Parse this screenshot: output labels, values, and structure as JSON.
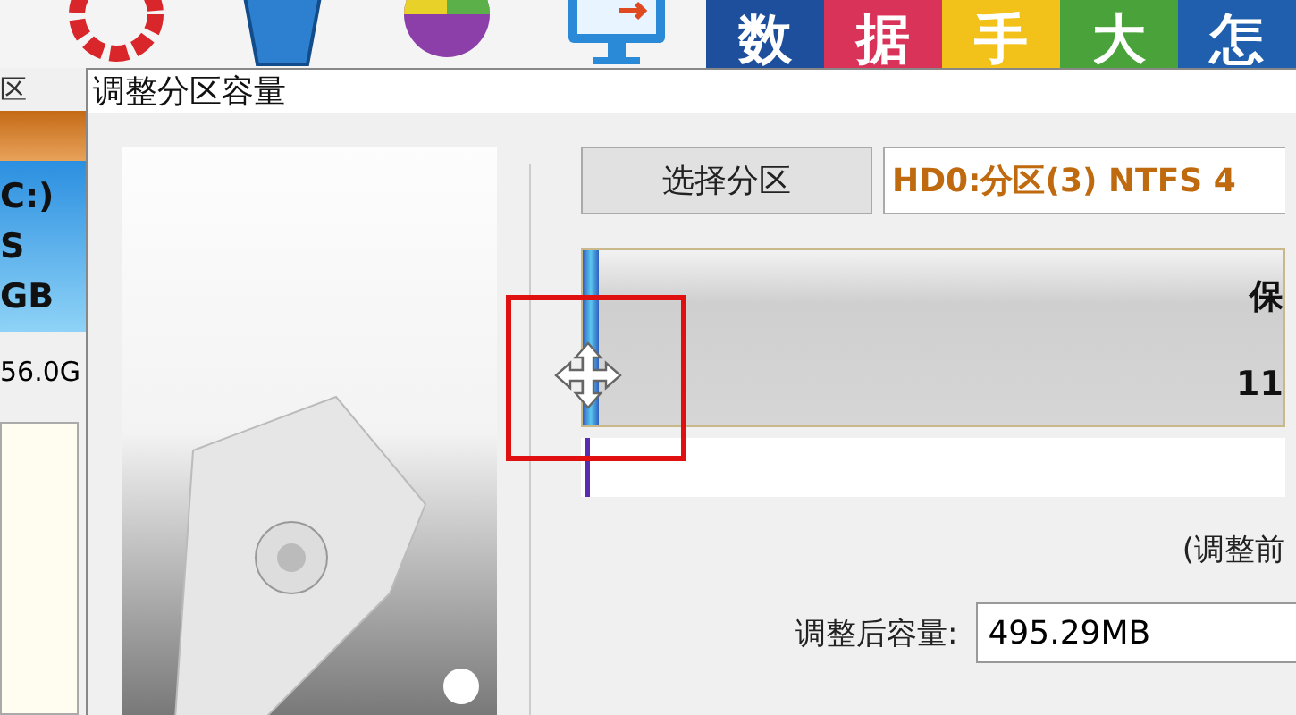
{
  "banner": {
    "tiles": [
      {
        "text": "数",
        "color": "#1d4f9c"
      },
      {
        "text": "据",
        "color": "#d9335a"
      },
      {
        "text": "手",
        "color": "#f2c21b"
      },
      {
        "text": "大",
        "color": "#4aa33a"
      },
      {
        "text": "怎",
        "color": "#1f5fae"
      }
    ]
  },
  "background_window": {
    "tab_label": "区",
    "partition_lines": [
      "C:)",
      "S",
      "GB"
    ],
    "size": "56.0G"
  },
  "dialog": {
    "title": "调整分区容量",
    "select_button": "选择分区",
    "partition_field": {
      "value": "HD0:分区(3) NTFS 4"
    },
    "partition_bar": {
      "label_lines": [
        "保",
        "11"
      ]
    },
    "note": "(调整前",
    "size_label": "调整后容量:",
    "size_field": {
      "value": "495.29MB"
    }
  }
}
